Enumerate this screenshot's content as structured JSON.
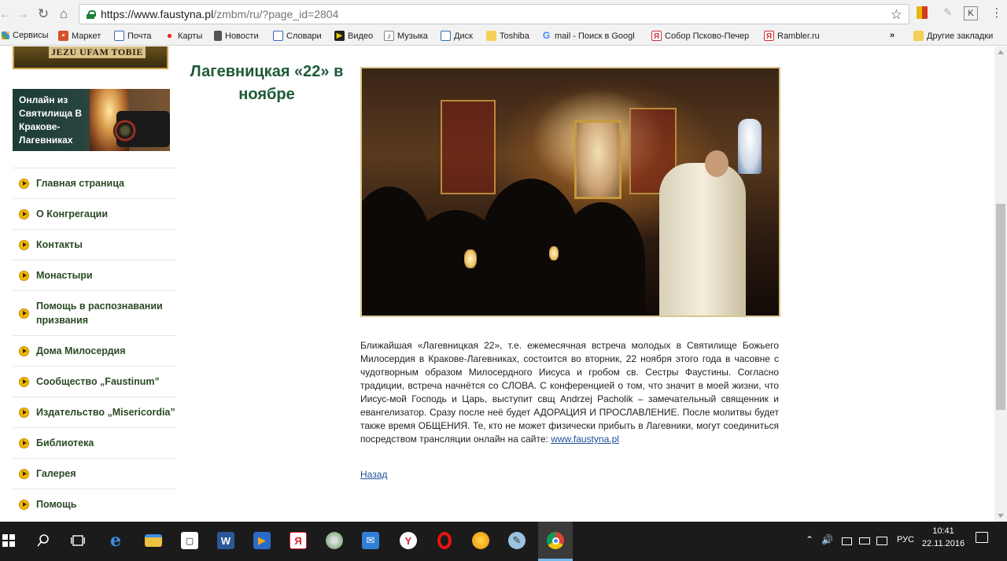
{
  "browser": {
    "url_prefix": "https://www.faustyna.pl",
    "url_rest": "/zmbm/ru/?page_id=2804",
    "bookmarks": [
      "Сервисы",
      "Маркет",
      "Почта",
      "Карты",
      "Новости",
      "Словари",
      "Видео",
      "Музыка",
      "Диск",
      "Toshiba",
      "mail - Поиск в Googl",
      "Собор Псково-Печер",
      "Rambler.ru"
    ],
    "other_bookmarks": "Другие закладки",
    "more": "»"
  },
  "sidebar": {
    "top_banner_text": "JEZU UFAM TOBIE",
    "online_banner_text": "Онлайн из Святилища В Кракове-Лагевниках",
    "menu": [
      {
        "label": "Главная страница"
      },
      {
        "label": "О Конгрегации"
      },
      {
        "label": "Контакты"
      },
      {
        "label": "Монастыри"
      },
      {
        "label": "Помощь в распознавании призвания"
      },
      {
        "label": "Дома Милосердия"
      },
      {
        "label": "Сообщество „Faustinum”"
      },
      {
        "label": "Издательство „Misericordia”"
      },
      {
        "label": "Библиотека"
      },
      {
        "label": "Галерея"
      },
      {
        "label": "Помощь"
      }
    ]
  },
  "article": {
    "title": "Лагевницкая «22» в ноябре",
    "body": "Ближайшая «Лагевницкая 22», т.е. ежемесячная встреча молодых в Святилище Божьего Милосердия в Кракове-Лагевниках, состоится во вторник, 22 ноября этого года в часовне с чудотворным образом Милосердного Иисуса и гробом св. Сестры Фаустины. Согласно традиции, встреча начнётся со СЛОВА. С конференцией о том, что значит в моей жизни, что Иисус-мой Господь и Царь, выступит свщ Andrzej Pacholik – замечательный священник и евангелизатор. Сразу после неё будет АДОРАЦИЯ И ПРОСЛАВЛЕНИЕ. После молитвы будет также время ОБЩЕНИЯ. Те, кто не может физически прибыть в Лагевники, могут соединиться посредством трансляции онлайн на сайте: ",
    "link_text": "www.faustyna.pl",
    "back_label": "Назад"
  },
  "taskbar": {
    "lang": "РУС",
    "time": "10:41",
    "date": "22.11.2016"
  },
  "colors": {
    "title_green": "#1f5a37",
    "menu_green": "#2a4a24",
    "bullet_yellow": "#f2b800",
    "link_blue": "#1f4f9a"
  }
}
